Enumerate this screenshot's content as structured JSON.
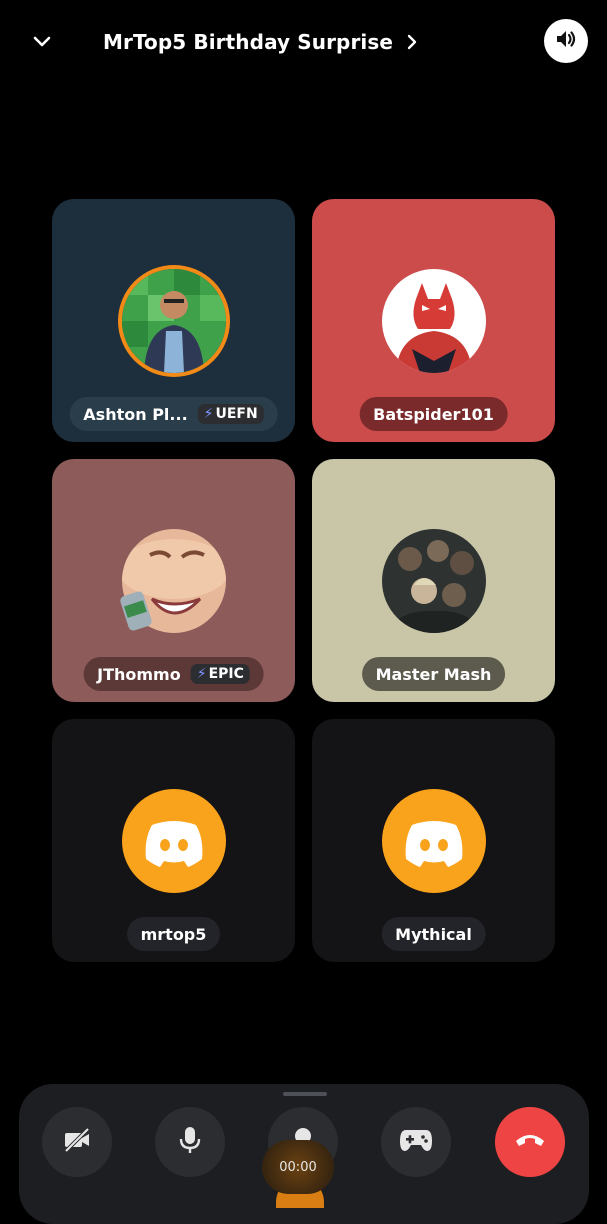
{
  "header": {
    "title": "MrTop5 Birthday Surprise",
    "back_icon": "chevron-down-icon",
    "title_chevron_icon": "chevron-right-icon",
    "speaker_icon": "speaker-icon"
  },
  "participants": [
    {
      "name": "Ashton Pl...",
      "badge": "UEFN",
      "tile_color": "#1d2f3c",
      "plate_color": "#2a3d4b"
    },
    {
      "name": "Batspider101",
      "badge": "",
      "tile_color": "#cc4c4c",
      "plate_color": "#7a2a2a"
    },
    {
      "name": "JThommo",
      "badge": "EPIC",
      "tile_color": "#8c5b5a",
      "plate_color": "#5c3837"
    },
    {
      "name": "Master Mash",
      "badge": "",
      "tile_color": "#c9c6a8",
      "plate_color": "#5d5b4d"
    },
    {
      "name": "mrtop5",
      "badge": "",
      "tile_color": "#141416",
      "plate_color": "#23242a"
    },
    {
      "name": "Mythical",
      "badge": "",
      "tile_color": "#141416",
      "plate_color": "#23242a"
    }
  ],
  "controls": {
    "timer": "00:00",
    "buttons": [
      "camera-off-icon",
      "microphone-icon",
      "screen-share-icon",
      "game-controller-icon",
      "hang-up-icon"
    ],
    "hangup_color": "#ef4444",
    "accent_orange": "#f9a21b"
  }
}
